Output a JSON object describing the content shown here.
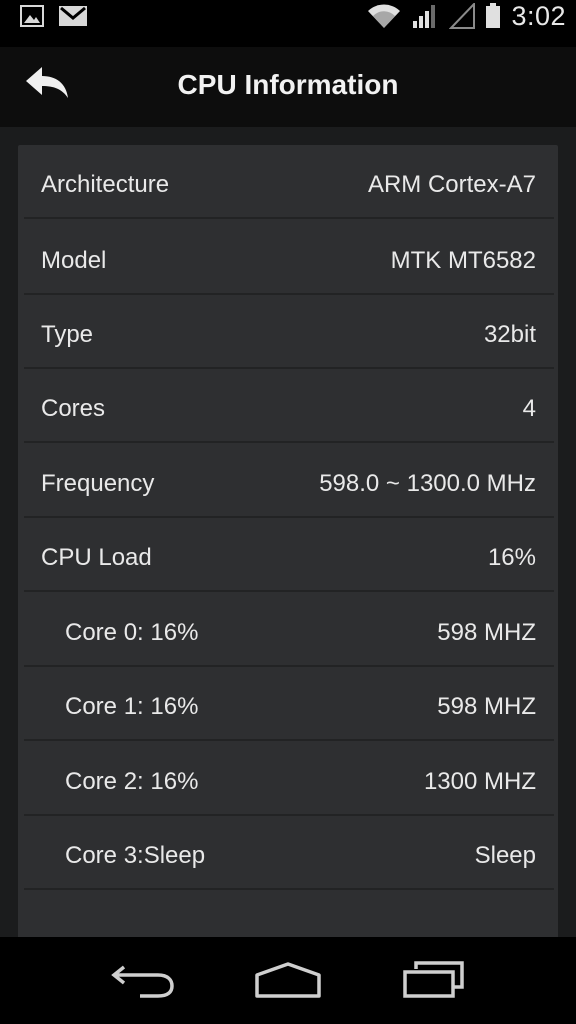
{
  "status_bar": {
    "time": "3:02",
    "icons": [
      "image-icon",
      "gmail-icon",
      "wifi-icon",
      "signal-icon",
      "signal-empty-icon",
      "battery-icon"
    ]
  },
  "action_bar": {
    "title": "CPU Information",
    "back_icon": "back-arrow-icon"
  },
  "rows": [
    {
      "label": "Architecture",
      "value": "ARM Cortex-A7"
    },
    {
      "label": "Model",
      "value": "MTK MT6582"
    },
    {
      "label": "Type",
      "value": "32bit"
    },
    {
      "label": "Cores",
      "value": "4"
    },
    {
      "label": "Frequency",
      "value": "598.0 ~ 1300.0 MHz"
    },
    {
      "label": "CPU Load",
      "value": "16%"
    },
    {
      "label": "Core 0: 16%",
      "value": "598 MHZ"
    },
    {
      "label": "Core 1: 16%",
      "value": "598 MHZ"
    },
    {
      "label": "Core 2: 16%",
      "value": "1300 MHZ"
    },
    {
      "label": "Core 3:Sleep",
      "value": "Sleep"
    }
  ],
  "nav_bar": {
    "icons": [
      "nav-back-icon",
      "home-icon",
      "recent-apps-icon"
    ]
  }
}
